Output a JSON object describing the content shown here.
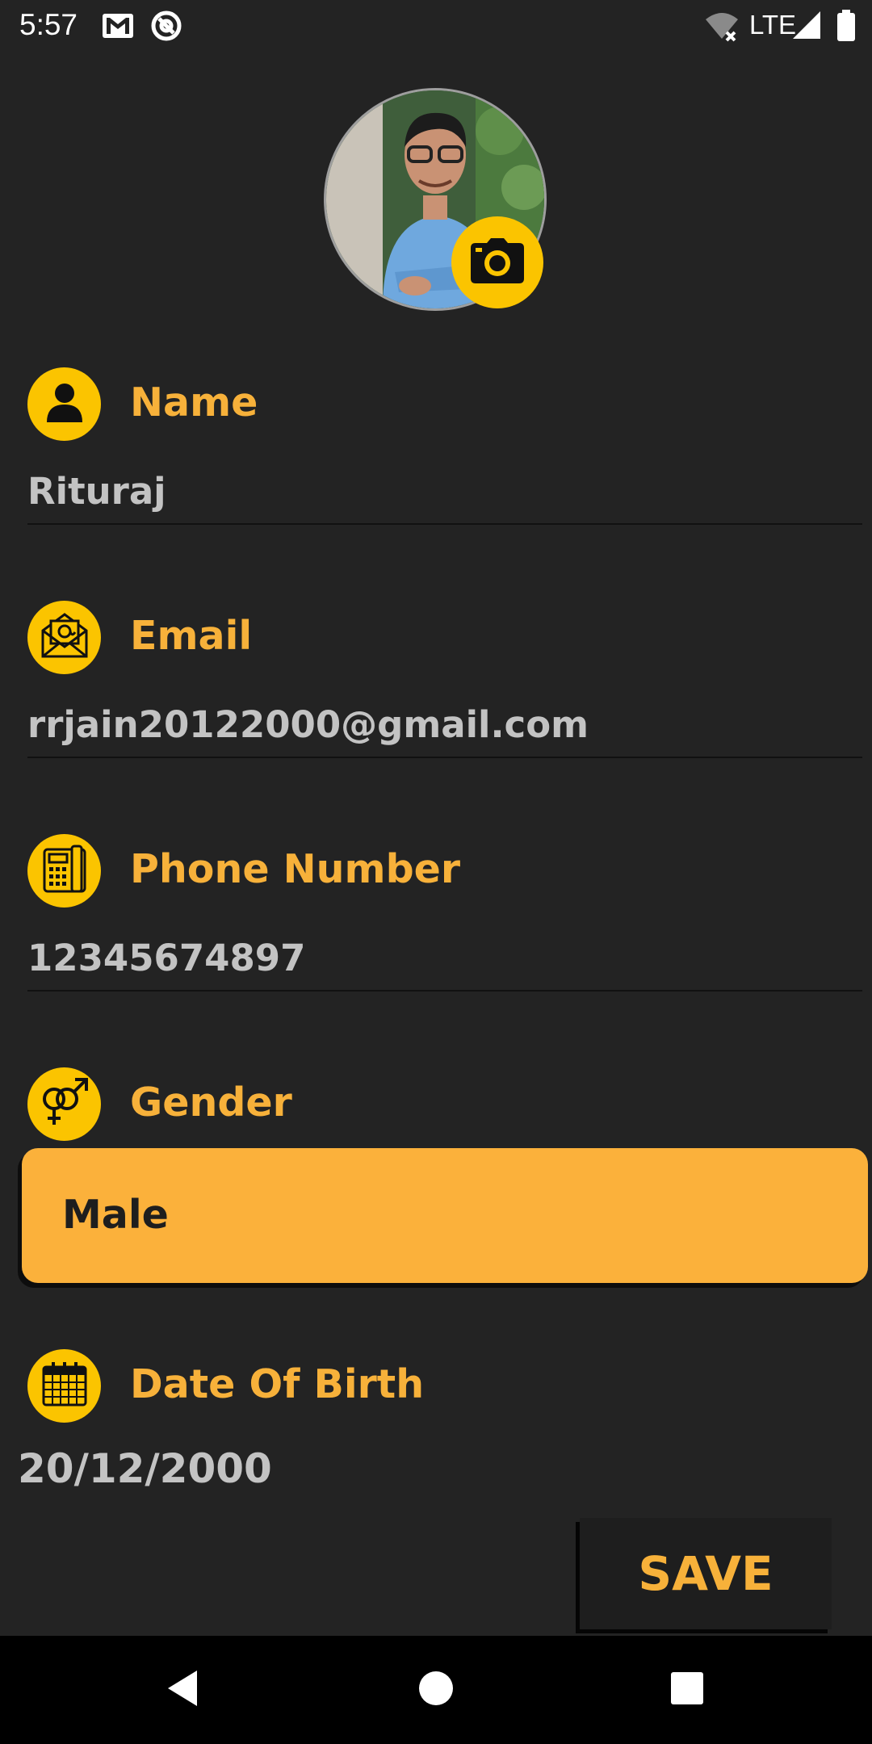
{
  "status_bar": {
    "time": "5:57",
    "network": "LTE",
    "icons": [
      "gmail-icon",
      "at-sign-icon",
      "wifi-off-icon",
      "signal-icon",
      "battery-icon"
    ]
  },
  "profile": {
    "avatar_icon": "profile-photo",
    "camera_icon": "camera-icon"
  },
  "fields": {
    "name": {
      "label": "Name",
      "value": "Rituraj",
      "icon": "person-icon"
    },
    "email": {
      "label": "Email",
      "value": "rrjain20122000@gmail.com",
      "icon": "email-icon"
    },
    "phone": {
      "label": "Phone Number",
      "value": "12345674897",
      "icon": "phone-icon"
    },
    "gender": {
      "label": "Gender",
      "value": "Male",
      "icon": "gender-icon"
    },
    "dob": {
      "label": "Date Of Birth",
      "value": "20/12/2000",
      "icon": "calendar-icon"
    }
  },
  "actions": {
    "save_label": "SAVE"
  },
  "colors": {
    "background": "#232323",
    "accent": "#f7b13a",
    "icon_bg": "#fbc400",
    "value_text": "#c3c3c3"
  },
  "navbar": {
    "icons": [
      "back-icon",
      "home-icon",
      "recents-icon"
    ]
  }
}
